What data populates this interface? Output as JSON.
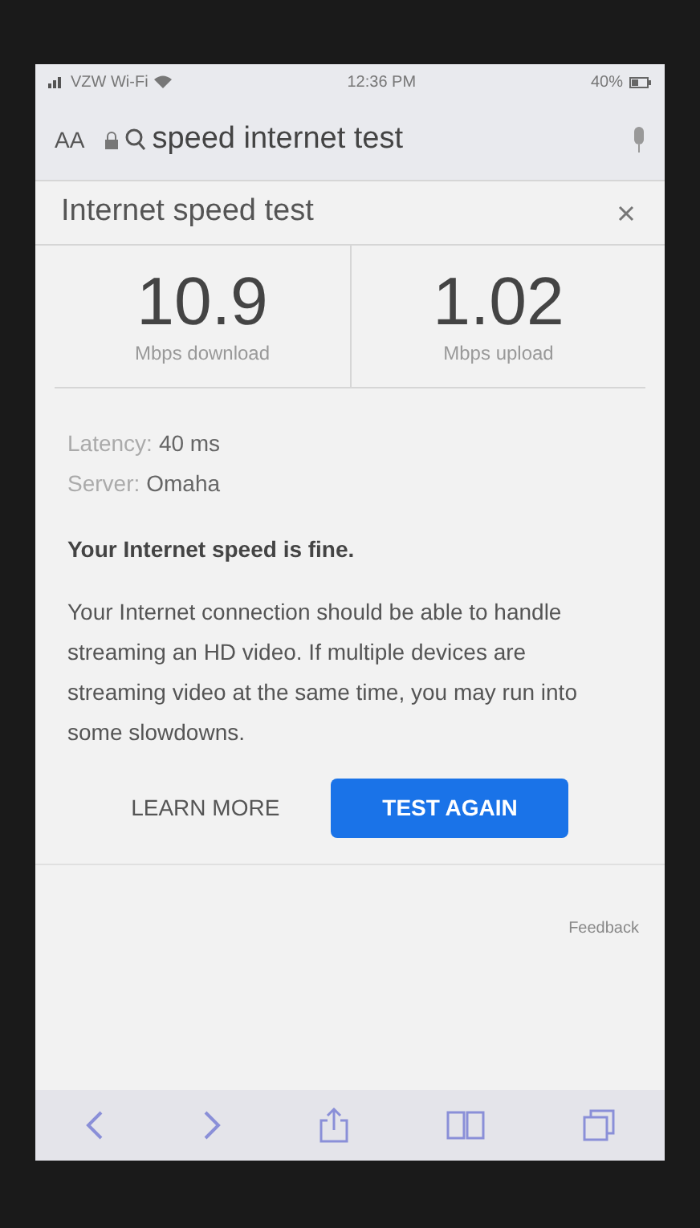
{
  "status_bar": {
    "carrier": "VZW Wi-Fi",
    "time": "12:36 PM",
    "battery": "40%"
  },
  "address_bar": {
    "text_size": "AA",
    "query": "speed internet test"
  },
  "card": {
    "title": "Internet speed test",
    "results": [
      {
        "value": "10.9",
        "label": "Mbps download"
      },
      {
        "value": "1.02",
        "label": "Mbps upload"
      }
    ],
    "details": [
      {
        "label": "Latency:",
        "value": "40 ms"
      },
      {
        "label": "Server:",
        "value": "Omaha"
      }
    ],
    "verdict": "Your Internet speed is fine.",
    "description": "Your Internet connection should be able to handle streaming an HD video. If multiple devices are streaming video at the same time, you may run into some slowdowns.",
    "buttons": [
      {
        "label": "LEARN MORE",
        "kind": "text"
      },
      {
        "label": "TEST AGAIN",
        "kind": "primary"
      }
    ],
    "feedback": "Feedback"
  }
}
